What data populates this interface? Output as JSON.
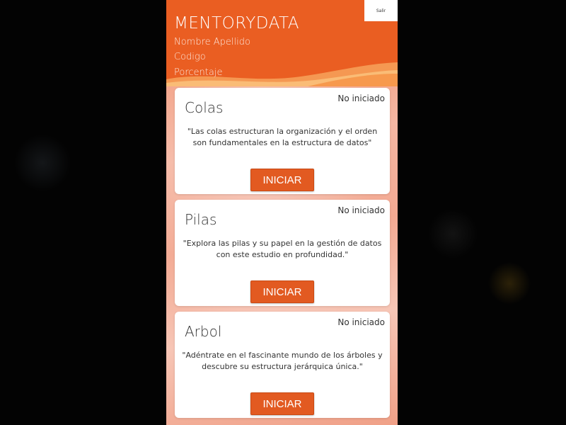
{
  "app": {
    "title": "MENTORYDATA",
    "exit_label": "Salir"
  },
  "user": {
    "name_label": "Nombre Apellido",
    "code_label": "Codigo",
    "percentage_label": "Porcentaje"
  },
  "colors": {
    "brand_orange": "#ea5e22",
    "button_orange": "#e25a21",
    "card_bg": "#ffffff"
  },
  "courses": [
    {
      "title": "Colas",
      "status": "No iniciado",
      "description": "\"Las colas estructuran la organización y el orden son fundamentales en la estructura de datos\"",
      "button_label": "INICIAR"
    },
    {
      "title": "Pilas",
      "status": "No iniciado",
      "description": "\"Explora las pilas y su papel en la gestión de datos con este estudio en profundidad.\"",
      "button_label": "INICIAR"
    },
    {
      "title": "Arbol",
      "status": "No iniciado",
      "description": "\"Adéntrate en el fascinante mundo de los árboles y descubre su estructura jerárquica única.\"",
      "button_label": "INICIAR"
    }
  ]
}
